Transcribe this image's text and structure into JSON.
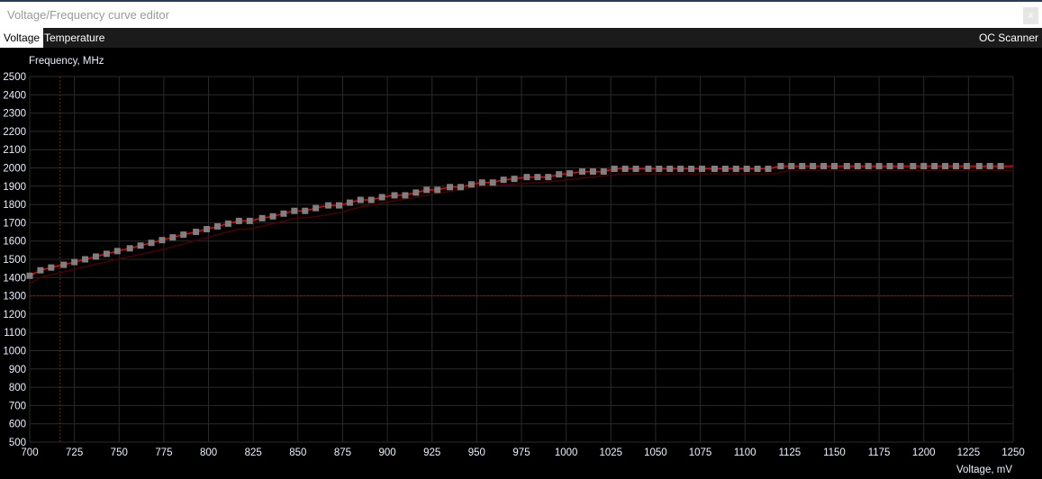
{
  "window": {
    "title": "Voltage/Frequency curve editor",
    "close_label": "x"
  },
  "tabs": [
    {
      "label": "Voltage",
      "active": true
    },
    {
      "label": "Temperature",
      "active": false
    }
  ],
  "oc_scanner_label": "OC Scanner",
  "colors": {
    "curve": "#ff0000",
    "point": "#808080",
    "grid": "#2a2a2a",
    "reference": "#4a0000",
    "marker": "#8b1a1a"
  },
  "chart_data": {
    "type": "line",
    "ylabel": "Frequency, MHz",
    "xlabel": "Voltage, mV",
    "xlim": [
      700,
      1250
    ],
    "ylim": [
      500,
      2500
    ],
    "xticks": [
      700,
      725,
      750,
      775,
      800,
      825,
      850,
      875,
      900,
      925,
      950,
      975,
      1000,
      1025,
      1050,
      1075,
      1100,
      1125,
      1150,
      1175,
      1200,
      1225,
      1250
    ],
    "yticks": [
      500,
      600,
      700,
      800,
      900,
      1000,
      1100,
      1200,
      1300,
      1400,
      1500,
      1600,
      1700,
      1800,
      1900,
      2000,
      2100,
      2200,
      2300,
      2400,
      2500
    ],
    "grid": true,
    "marker_voltage": 717,
    "marker_frequency": 1300,
    "series": [
      {
        "name": "curve",
        "x": [
          700,
          706,
          712,
          719,
          725,
          731,
          737,
          743,
          749,
          756,
          762,
          768,
          774,
          780,
          786,
          793,
          799,
          805,
          811,
          817,
          823,
          830,
          836,
          842,
          848,
          854,
          860,
          867,
          873,
          879,
          885,
          891,
          897,
          904,
          910,
          916,
          922,
          928,
          935,
          941,
          947,
          953,
          959,
          965,
          971,
          978,
          984,
          990,
          996,
          1002,
          1009,
          1015,
          1021,
          1027,
          1033,
          1039,
          1046,
          1052,
          1058,
          1064,
          1070,
          1076,
          1083,
          1089,
          1095,
          1101,
          1107,
          1113,
          1120,
          1126,
          1132,
          1138,
          1144,
          1150,
          1157,
          1163,
          1169,
          1175,
          1181,
          1187,
          1194,
          1200,
          1206,
          1212,
          1218,
          1224,
          1231,
          1237,
          1243
        ],
        "y": [
          1410,
          1440,
          1455,
          1470,
          1485,
          1500,
          1515,
          1530,
          1545,
          1560,
          1575,
          1590,
          1605,
          1620,
          1635,
          1650,
          1665,
          1680,
          1695,
          1710,
          1710,
          1725,
          1735,
          1750,
          1765,
          1765,
          1780,
          1795,
          1795,
          1810,
          1825,
          1825,
          1840,
          1850,
          1850,
          1865,
          1880,
          1880,
          1895,
          1895,
          1910,
          1920,
          1920,
          1935,
          1940,
          1950,
          1950,
          1950,
          1965,
          1970,
          1980,
          1980,
          1980,
          1995,
          1995,
          1995,
          1995,
          1995,
          1995,
          1995,
          1995,
          1995,
          1995,
          1995,
          1995,
          1995,
          1995,
          1995,
          2010,
          2010,
          2010,
          2010,
          2010,
          2010,
          2010,
          2010,
          2010,
          2010,
          2010,
          2010,
          2010,
          2010,
          2010,
          2010,
          2010,
          2010,
          2010,
          2010,
          2010
        ]
      },
      {
        "name": "reference",
        "x": [
          700,
          706,
          749,
          775,
          816,
          824,
          850,
          856,
          874,
          885,
          901,
          952,
          986,
          999,
          1018,
          1032,
          1117,
          1124,
          1250
        ],
        "y": [
          1367,
          1401,
          1500,
          1554,
          1663,
          1667,
          1727,
          1727,
          1756,
          1786,
          1815,
          1900,
          1920,
          1933,
          1953,
          1968,
          1968,
          1985,
          1985
        ]
      }
    ]
  }
}
